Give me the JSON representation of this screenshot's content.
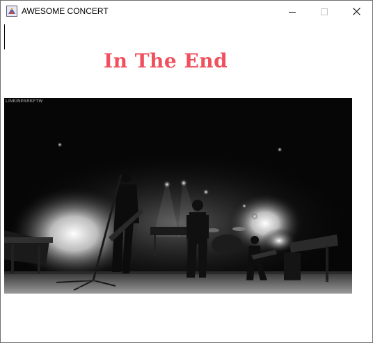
{
  "window": {
    "title": "AWESOME CONCERT",
    "controls": {
      "minimize_icon": "minimize-icon",
      "maximize_icon": "maximize-icon",
      "close_icon": "close-icon"
    }
  },
  "content": {
    "song_title": "In The End",
    "song_title_color": "#f0505e",
    "photo": {
      "description_icon": "concert-photo",
      "watermark": "LINKINPARKFTW"
    }
  }
}
